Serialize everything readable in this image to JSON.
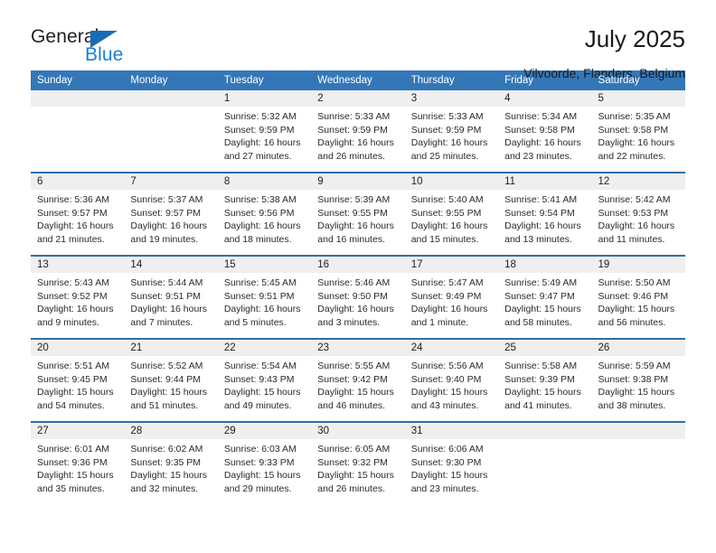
{
  "brand": {
    "word_general": "General",
    "word_blue": "Blue",
    "triangle_color": "#1b6cb5",
    "blue_color": "#1b7fd4"
  },
  "header": {
    "title": "July 2025",
    "location": "Vilvoorde, Flanders, Belgium"
  },
  "theme": {
    "header_row_bg": "#3477b8",
    "row_divider": "#2f6ea8",
    "daynum_band_bg": "#efefef",
    "page_bg": "#ffffff"
  },
  "weekdays": [
    "Sunday",
    "Monday",
    "Tuesday",
    "Wednesday",
    "Thursday",
    "Friday",
    "Saturday"
  ],
  "weeks": [
    [
      {
        "day": "",
        "sunrise": "",
        "sunset": "",
        "daylight_1": "",
        "daylight_2": ""
      },
      {
        "day": "",
        "sunrise": "",
        "sunset": "",
        "daylight_1": "",
        "daylight_2": ""
      },
      {
        "day": "1",
        "sunrise": "Sunrise: 5:32 AM",
        "sunset": "Sunset: 9:59 PM",
        "daylight_1": "Daylight: 16 hours",
        "daylight_2": "and 27 minutes."
      },
      {
        "day": "2",
        "sunrise": "Sunrise: 5:33 AM",
        "sunset": "Sunset: 9:59 PM",
        "daylight_1": "Daylight: 16 hours",
        "daylight_2": "and 26 minutes."
      },
      {
        "day": "3",
        "sunrise": "Sunrise: 5:33 AM",
        "sunset": "Sunset: 9:59 PM",
        "daylight_1": "Daylight: 16 hours",
        "daylight_2": "and 25 minutes."
      },
      {
        "day": "4",
        "sunrise": "Sunrise: 5:34 AM",
        "sunset": "Sunset: 9:58 PM",
        "daylight_1": "Daylight: 16 hours",
        "daylight_2": "and 23 minutes."
      },
      {
        "day": "5",
        "sunrise": "Sunrise: 5:35 AM",
        "sunset": "Sunset: 9:58 PM",
        "daylight_1": "Daylight: 16 hours",
        "daylight_2": "and 22 minutes."
      }
    ],
    [
      {
        "day": "6",
        "sunrise": "Sunrise: 5:36 AM",
        "sunset": "Sunset: 9:57 PM",
        "daylight_1": "Daylight: 16 hours",
        "daylight_2": "and 21 minutes."
      },
      {
        "day": "7",
        "sunrise": "Sunrise: 5:37 AM",
        "sunset": "Sunset: 9:57 PM",
        "daylight_1": "Daylight: 16 hours",
        "daylight_2": "and 19 minutes."
      },
      {
        "day": "8",
        "sunrise": "Sunrise: 5:38 AM",
        "sunset": "Sunset: 9:56 PM",
        "daylight_1": "Daylight: 16 hours",
        "daylight_2": "and 18 minutes."
      },
      {
        "day": "9",
        "sunrise": "Sunrise: 5:39 AM",
        "sunset": "Sunset: 9:55 PM",
        "daylight_1": "Daylight: 16 hours",
        "daylight_2": "and 16 minutes."
      },
      {
        "day": "10",
        "sunrise": "Sunrise: 5:40 AM",
        "sunset": "Sunset: 9:55 PM",
        "daylight_1": "Daylight: 16 hours",
        "daylight_2": "and 15 minutes."
      },
      {
        "day": "11",
        "sunrise": "Sunrise: 5:41 AM",
        "sunset": "Sunset: 9:54 PM",
        "daylight_1": "Daylight: 16 hours",
        "daylight_2": "and 13 minutes."
      },
      {
        "day": "12",
        "sunrise": "Sunrise: 5:42 AM",
        "sunset": "Sunset: 9:53 PM",
        "daylight_1": "Daylight: 16 hours",
        "daylight_2": "and 11 minutes."
      }
    ],
    [
      {
        "day": "13",
        "sunrise": "Sunrise: 5:43 AM",
        "sunset": "Sunset: 9:52 PM",
        "daylight_1": "Daylight: 16 hours",
        "daylight_2": "and 9 minutes."
      },
      {
        "day": "14",
        "sunrise": "Sunrise: 5:44 AM",
        "sunset": "Sunset: 9:51 PM",
        "daylight_1": "Daylight: 16 hours",
        "daylight_2": "and 7 minutes."
      },
      {
        "day": "15",
        "sunrise": "Sunrise: 5:45 AM",
        "sunset": "Sunset: 9:51 PM",
        "daylight_1": "Daylight: 16 hours",
        "daylight_2": "and 5 minutes."
      },
      {
        "day": "16",
        "sunrise": "Sunrise: 5:46 AM",
        "sunset": "Sunset: 9:50 PM",
        "daylight_1": "Daylight: 16 hours",
        "daylight_2": "and 3 minutes."
      },
      {
        "day": "17",
        "sunrise": "Sunrise: 5:47 AM",
        "sunset": "Sunset: 9:49 PM",
        "daylight_1": "Daylight: 16 hours",
        "daylight_2": "and 1 minute."
      },
      {
        "day": "18",
        "sunrise": "Sunrise: 5:49 AM",
        "sunset": "Sunset: 9:47 PM",
        "daylight_1": "Daylight: 15 hours",
        "daylight_2": "and 58 minutes."
      },
      {
        "day": "19",
        "sunrise": "Sunrise: 5:50 AM",
        "sunset": "Sunset: 9:46 PM",
        "daylight_1": "Daylight: 15 hours",
        "daylight_2": "and 56 minutes."
      }
    ],
    [
      {
        "day": "20",
        "sunrise": "Sunrise: 5:51 AM",
        "sunset": "Sunset: 9:45 PM",
        "daylight_1": "Daylight: 15 hours",
        "daylight_2": "and 54 minutes."
      },
      {
        "day": "21",
        "sunrise": "Sunrise: 5:52 AM",
        "sunset": "Sunset: 9:44 PM",
        "daylight_1": "Daylight: 15 hours",
        "daylight_2": "and 51 minutes."
      },
      {
        "day": "22",
        "sunrise": "Sunrise: 5:54 AM",
        "sunset": "Sunset: 9:43 PM",
        "daylight_1": "Daylight: 15 hours",
        "daylight_2": "and 49 minutes."
      },
      {
        "day": "23",
        "sunrise": "Sunrise: 5:55 AM",
        "sunset": "Sunset: 9:42 PM",
        "daylight_1": "Daylight: 15 hours",
        "daylight_2": "and 46 minutes."
      },
      {
        "day": "24",
        "sunrise": "Sunrise: 5:56 AM",
        "sunset": "Sunset: 9:40 PM",
        "daylight_1": "Daylight: 15 hours",
        "daylight_2": "and 43 minutes."
      },
      {
        "day": "25",
        "sunrise": "Sunrise: 5:58 AM",
        "sunset": "Sunset: 9:39 PM",
        "daylight_1": "Daylight: 15 hours",
        "daylight_2": "and 41 minutes."
      },
      {
        "day": "26",
        "sunrise": "Sunrise: 5:59 AM",
        "sunset": "Sunset: 9:38 PM",
        "daylight_1": "Daylight: 15 hours",
        "daylight_2": "and 38 minutes."
      }
    ],
    [
      {
        "day": "27",
        "sunrise": "Sunrise: 6:01 AM",
        "sunset": "Sunset: 9:36 PM",
        "daylight_1": "Daylight: 15 hours",
        "daylight_2": "and 35 minutes."
      },
      {
        "day": "28",
        "sunrise": "Sunrise: 6:02 AM",
        "sunset": "Sunset: 9:35 PM",
        "daylight_1": "Daylight: 15 hours",
        "daylight_2": "and 32 minutes."
      },
      {
        "day": "29",
        "sunrise": "Sunrise: 6:03 AM",
        "sunset": "Sunset: 9:33 PM",
        "daylight_1": "Daylight: 15 hours",
        "daylight_2": "and 29 minutes."
      },
      {
        "day": "30",
        "sunrise": "Sunrise: 6:05 AM",
        "sunset": "Sunset: 9:32 PM",
        "daylight_1": "Daylight: 15 hours",
        "daylight_2": "and 26 minutes."
      },
      {
        "day": "31",
        "sunrise": "Sunrise: 6:06 AM",
        "sunset": "Sunset: 9:30 PM",
        "daylight_1": "Daylight: 15 hours",
        "daylight_2": "and 23 minutes."
      },
      {
        "day": "",
        "sunrise": "",
        "sunset": "",
        "daylight_1": "",
        "daylight_2": ""
      },
      {
        "day": "",
        "sunrise": "",
        "sunset": "",
        "daylight_1": "",
        "daylight_2": ""
      }
    ]
  ]
}
